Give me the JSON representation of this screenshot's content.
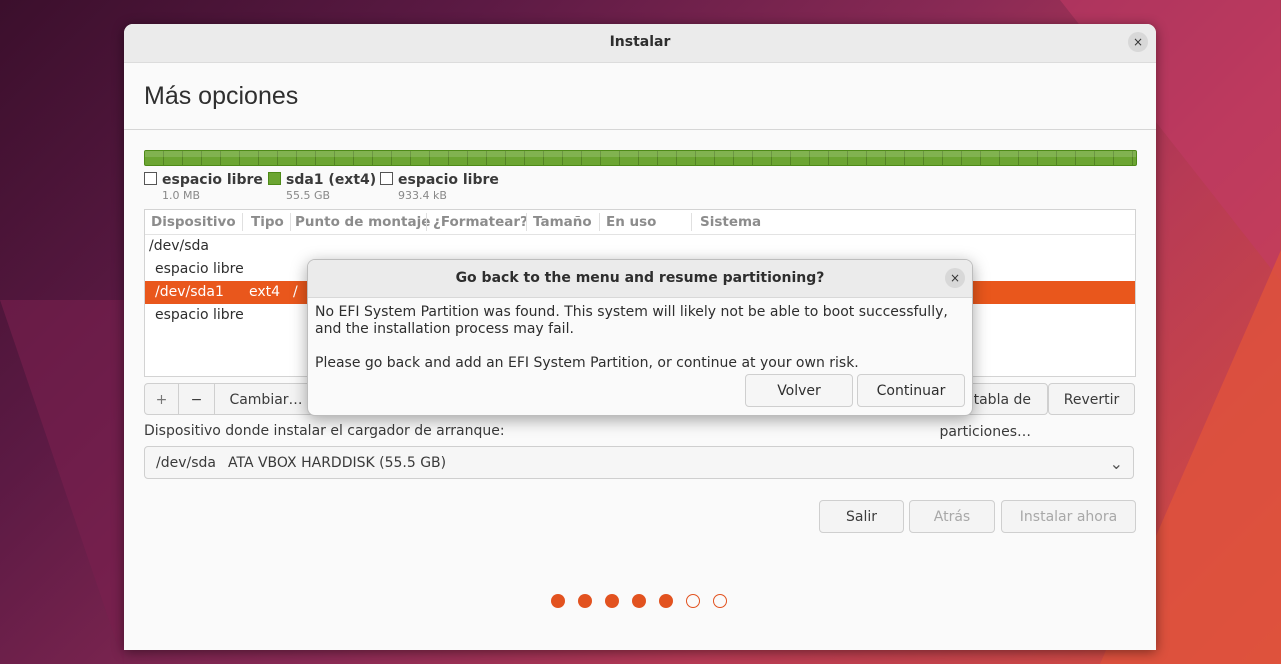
{
  "window": {
    "title": "Instalar",
    "close_icon": "×"
  },
  "page": {
    "title": "Más opciones"
  },
  "legend": [
    {
      "name": "espacio libre",
      "size": "1.0 MB",
      "color": "#ffffff"
    },
    {
      "name": "sda1 (ext4)",
      "size": "55.5 GB",
      "color": "#6ca532"
    },
    {
      "name": "espacio libre",
      "size": "933.4 kB",
      "color": "#ffffff"
    }
  ],
  "table": {
    "columns": [
      "Dispositivo",
      "Tipo",
      "Punto de montaje",
      "¿Formatear?",
      "Tamaño",
      "En uso",
      "Sistema"
    ],
    "rows": [
      {
        "device": "/dev/sda",
        "type": "",
        "mount": ""
      },
      {
        "device": "espacio libre",
        "type": "",
        "mount": ""
      },
      {
        "device": "/dev/sda1",
        "type": "ext4",
        "mount": "/",
        "selected": true
      },
      {
        "device": "espacio libre",
        "type": "",
        "mount": ""
      }
    ]
  },
  "toolbar": {
    "add": "+",
    "remove": "−",
    "change": "Cambiar…",
    "new_table": "Nueva tabla de particiones…",
    "revert": "Revertir"
  },
  "bootloader": {
    "label": "Dispositivo donde instalar el cargador de arranque:",
    "device": "/dev/sda",
    "name": "ATA VBOX HARDDISK (55.5 GB)",
    "chevron": "⌄"
  },
  "nav": {
    "quit": "Salir",
    "back": "Atrás",
    "install": "Instalar ahora"
  },
  "progress": {
    "total_steps": 7,
    "completed_steps": 5,
    "accent": "#e2521f"
  },
  "dialog": {
    "title": "Go back to the menu and resume partitioning?",
    "message1": "No EFI System Partition was found. This system will likely not be able to boot successfully, and the installation process may fail.",
    "message2": "Please go back and add an EFI System Partition, or continue at your own risk.",
    "back_button": "Volver",
    "continue_button": "Continuar",
    "close_icon": "×"
  }
}
